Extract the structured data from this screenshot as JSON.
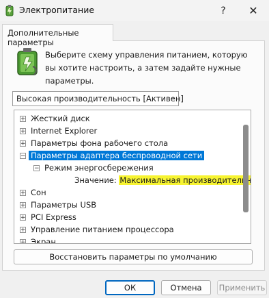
{
  "window": {
    "title": "Электропитание",
    "help_glyph": "?",
    "close_glyph": "✕",
    "icon": "power-battery-icon"
  },
  "tab": {
    "label": "Дополнительные параметры"
  },
  "description": "Выберите схему управления питанием, которую вы хотите настроить, а затем задайте нужные параметры.",
  "plan_select": {
    "value": "Высокая производительность [Активен]"
  },
  "tree": {
    "items": [
      {
        "label": "Жесткий диск",
        "expander": "+"
      },
      {
        "label": "Internet Explorer",
        "expander": "+"
      },
      {
        "label": "Параметры фона рабочего стола",
        "expander": "+"
      },
      {
        "label": "Параметры адаптера беспроводной сети",
        "expander": "−",
        "selected": true
      },
      {
        "label": "Режим энергосбережения",
        "expander": "−"
      },
      {
        "label": "Значение:",
        "value": "Максимальная производительность"
      },
      {
        "label": "Сон",
        "expander": "+"
      },
      {
        "label": "Параметры USB",
        "expander": "+"
      },
      {
        "label": "PCI Express",
        "expander": "+"
      },
      {
        "label": "Управление питанием процессора",
        "expander": "+"
      },
      {
        "label": "Экран",
        "expander": "+"
      }
    ]
  },
  "buttons": {
    "restore": "Восстановить параметры по умолчанию",
    "ok": "ОК",
    "cancel": "Отмена",
    "apply": "Применить"
  },
  "colors": {
    "selection": "#0078d7",
    "highlight": "#f7f431",
    "default_button_border": "#0067c0"
  }
}
